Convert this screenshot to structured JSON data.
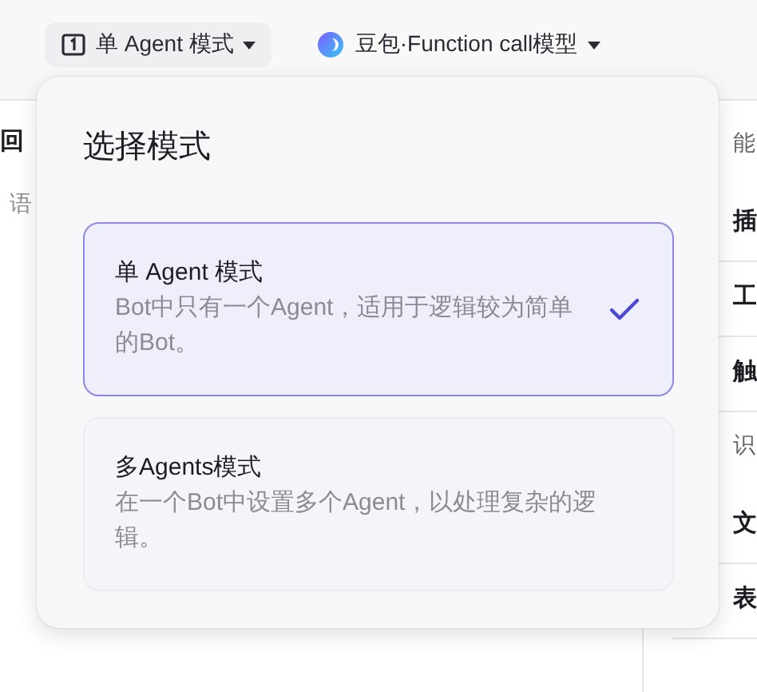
{
  "header": {
    "mode_button": {
      "label": "单 Agent 模式"
    },
    "model_selector": {
      "label": "豆包·Function call模型"
    }
  },
  "background": {
    "left_texts": [
      {
        "text": "回",
        "kind": "heading"
      },
      {
        "text": "语",
        "kind": "hint"
      }
    ],
    "right_texts": [
      {
        "text": "能",
        "kind": "section"
      },
      {
        "text": "插",
        "kind": "item"
      },
      {
        "text": "工",
        "kind": "item"
      },
      {
        "text": "触",
        "kind": "item"
      },
      {
        "text": "识",
        "kind": "section"
      },
      {
        "text": "文",
        "kind": "item"
      },
      {
        "text": "表",
        "kind": "item"
      }
    ]
  },
  "mode_popup": {
    "title": "选择模式",
    "options": [
      {
        "title": "单 Agent 模式",
        "description": "Bot中只有一个Agent，适用于逻辑较为简单的Bot。",
        "selected": true
      },
      {
        "title": "多Agents模式",
        "description": "在一个Bot中设置多个Agent，以处理复杂的逻辑。",
        "selected": false
      }
    ]
  }
}
